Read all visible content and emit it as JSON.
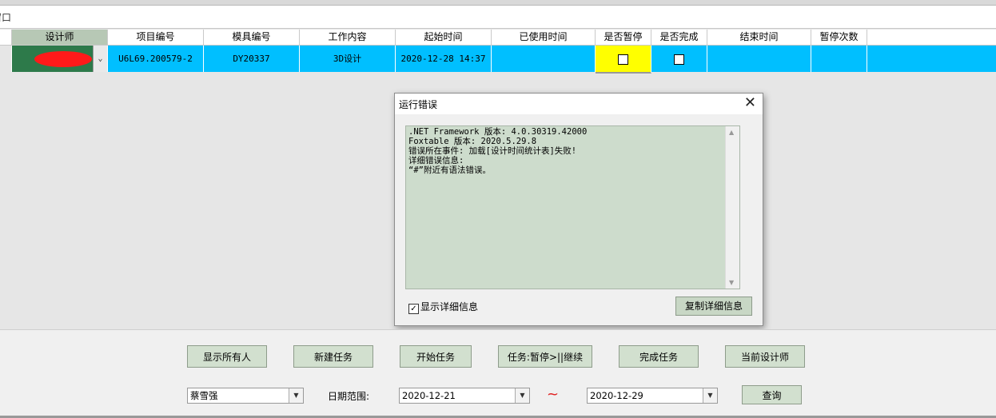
{
  "window": {
    "title": "窗口"
  },
  "grid": {
    "columns": [
      "设计师",
      "项目编号",
      "模具编号",
      "工作内容",
      "起始时间",
      "已使用时间",
      "是否暂停",
      "是否完成",
      "结束时间",
      "暂停次数"
    ],
    "row": {
      "designer": "",
      "project_no": "U6L69.200579-2",
      "mold_no": "DY20337",
      "work": "3D设计",
      "start_time": "2020-12-28 14:37",
      "used_time": "",
      "paused": false,
      "done": false,
      "end_time": "",
      "pause_count": ""
    },
    "colors": {
      "row_bg": "#00bfff",
      "highlight": "#ffff00",
      "selected_header": "#b7c8b5"
    }
  },
  "dialog": {
    "title": "运行错误",
    "lines": [
      ".NET Framework 版本: 4.0.30319.42000",
      "Foxtable 版本: 2020.5.29.8",
      "错误所在事件: 加载[设计时间统计表]失败!",
      "详细错误信息:",
      "“#”附近有语法错误。"
    ],
    "show_details_label": "显示详细信息",
    "show_details_checked": true,
    "copy_button": "复制详细信息"
  },
  "toolbar": {
    "buttons": [
      "显示所有人",
      "新建任务",
      "开始任务",
      "任务:暂停>||继续",
      "完成任务",
      "当前设计师"
    ],
    "designer_value": "蔡雪强",
    "date_label": "日期范围:",
    "date_from": "2020-12-21",
    "date_to": "2020-12-29",
    "tilde": "~",
    "query_button": "查询"
  }
}
